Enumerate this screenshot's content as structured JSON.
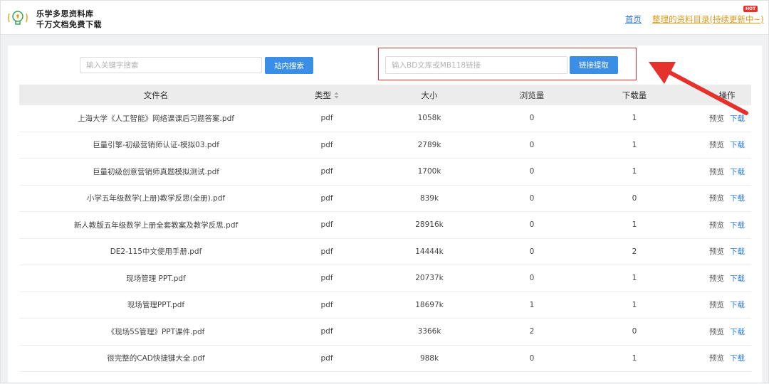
{
  "header": {
    "brand_line1": "乐学多思资料库",
    "brand_line2": "千万文档免费下载",
    "nav_home": "首页",
    "nav_catalog": "整理的资料目录(持续更新中~)",
    "hot_badge": "HOT"
  },
  "search": {
    "placeholder": "输入关键字搜索",
    "button": "站内搜索"
  },
  "link_extract": {
    "placeholder": "输入BD文库或MB118链接",
    "button": "链接提取"
  },
  "table": {
    "columns": {
      "name": "文件名",
      "type": "类型",
      "size": "大小",
      "views": "浏览量",
      "downloads": "下载量",
      "actions": "操作"
    },
    "action_preview": "预览",
    "action_download": "下载",
    "rows": [
      {
        "name": "上海大学《人工智能》网络课课后习题答案.pdf",
        "type": "pdf",
        "size": "1058k",
        "views": "0",
        "downloads": "1"
      },
      {
        "name": "巨量引擎-初级营销师认证-模拟03.pdf",
        "type": "pdf",
        "size": "2789k",
        "views": "0",
        "downloads": "1"
      },
      {
        "name": "巨量初级创意营销师真题模拟测试.pdf",
        "type": "pdf",
        "size": "1700k",
        "views": "0",
        "downloads": "1"
      },
      {
        "name": "小学五年级数学(上册)教学反思(全册).pdf",
        "type": "pdf",
        "size": "839k",
        "views": "0",
        "downloads": "0"
      },
      {
        "name": "新人教版五年级数学上册全套教案及教学反思.pdf",
        "type": "pdf",
        "size": "28916k",
        "views": "0",
        "downloads": "1"
      },
      {
        "name": "DE2-115中文使用手册.pdf",
        "type": "pdf",
        "size": "14444k",
        "views": "0",
        "downloads": "2"
      },
      {
        "name": "现场管理 PPT.pdf",
        "type": "pdf",
        "size": "20737k",
        "views": "0",
        "downloads": "1"
      },
      {
        "name": "现场管理PPT.pdf",
        "type": "pdf",
        "size": "18697k",
        "views": "1",
        "downloads": "1"
      },
      {
        "name": "《现场5S管理》PPT课件.pdf",
        "type": "pdf",
        "size": "3366k",
        "views": "2",
        "downloads": "0"
      },
      {
        "name": "很完整的CAD快捷键大全.pdf",
        "type": "pdf",
        "size": "988k",
        "views": "0",
        "downloads": "1"
      }
    ]
  },
  "colors": {
    "accent_button": "#3a8ee6",
    "link_blue": "#2b6fd8",
    "link_orange": "#d99a1a",
    "annotation_red": "#e5302b"
  },
  "icons": {
    "logo": "lightbulb-icon",
    "sort": "sort-icon",
    "annotation": "red-arrow-annotation"
  }
}
